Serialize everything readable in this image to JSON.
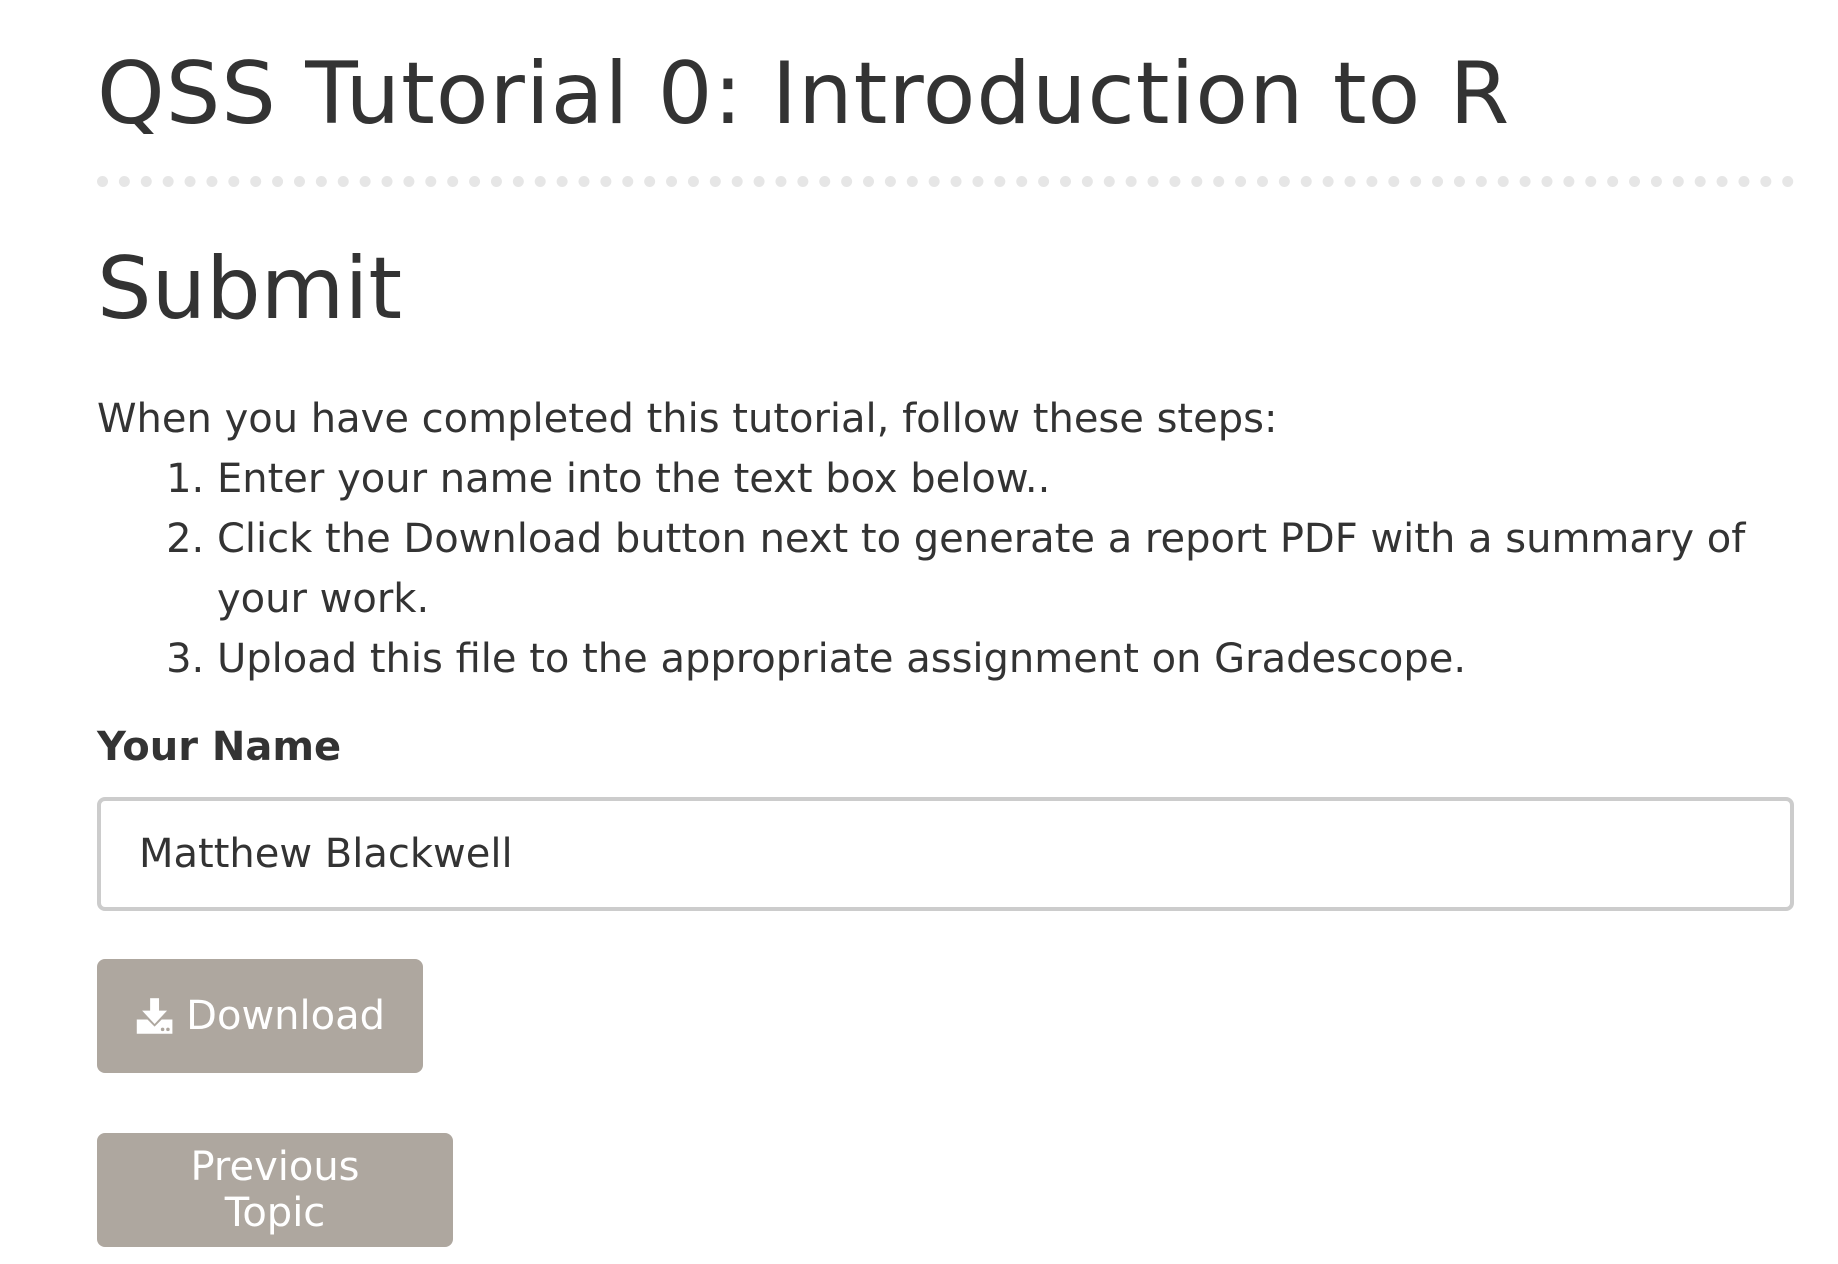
{
  "header": {
    "title": "QSS Tutorial 0: Introduction to R"
  },
  "section": {
    "title": "Submit",
    "intro": "When you have completed this tutorial, follow these steps:",
    "steps": [
      "Enter your name into the text box below..",
      "Click the Download button next to generate a report PDF with a summary of your work.",
      "Upload this file to the appropriate assignment on Gradescope."
    ]
  },
  "form": {
    "name_label": "Your Name",
    "name_value": "Matthew Blackwell",
    "download_label": "Download",
    "download_icon": "download-icon",
    "previous_label": "Previous Topic"
  },
  "colors": {
    "text": "#333333",
    "button_bg": "#aea79f",
    "button_text": "#ffffff",
    "input_border": "#cccccc",
    "rule": "#e6e6e6"
  }
}
